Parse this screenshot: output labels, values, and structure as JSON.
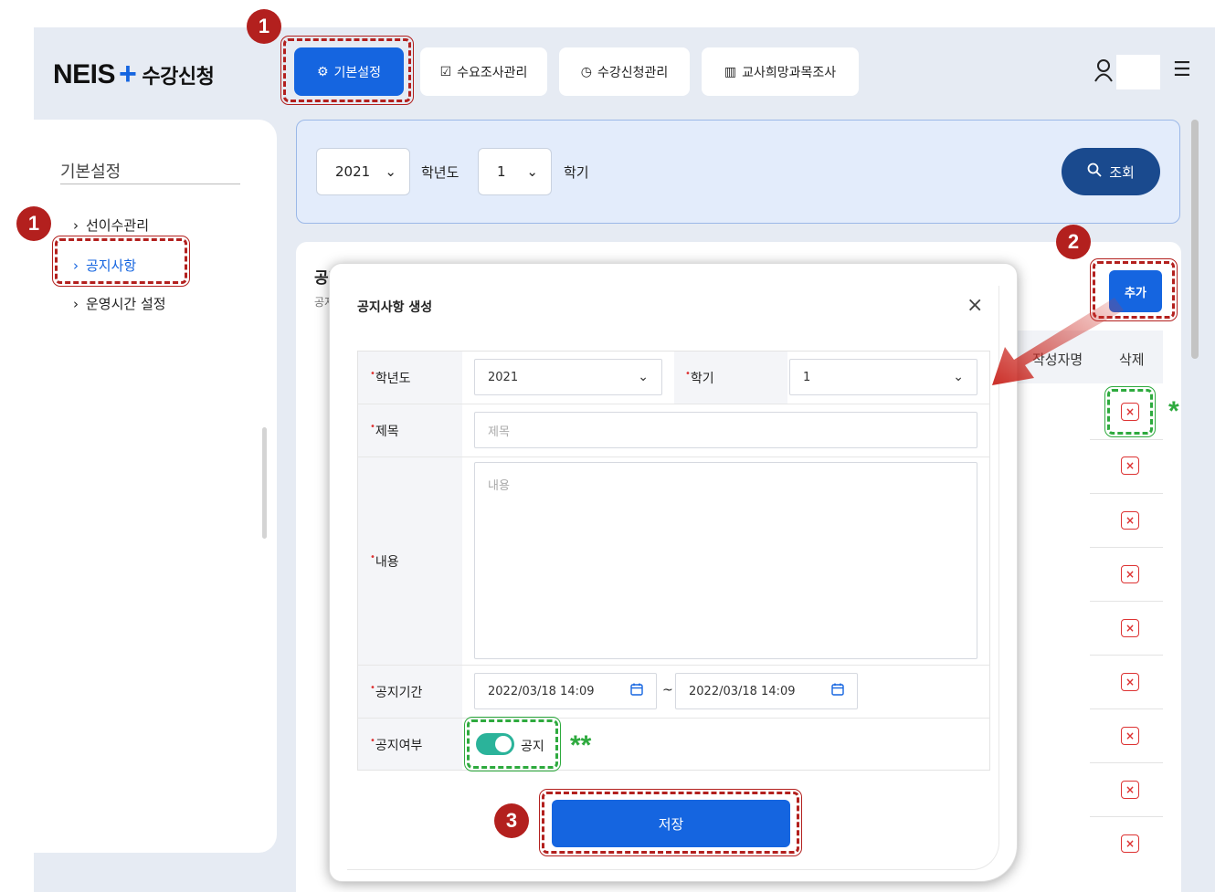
{
  "logo": {
    "brand": "NEIS",
    "plus": "+",
    "sub": "수강신청"
  },
  "tabs": [
    {
      "label": "기본설정",
      "icon": "gear-icon"
    },
    {
      "label": "수요조사관리",
      "icon": "check-circle-icon"
    },
    {
      "label": "수강신청관리",
      "icon": "clock-icon"
    },
    {
      "label": "교사희망과목조사",
      "icon": "bar-chart-icon"
    }
  ],
  "sidebar": {
    "title": "기본설정",
    "items": [
      "선이수관리",
      "공지사항",
      "운영시간 설정"
    ]
  },
  "filter": {
    "year": "2021",
    "year_label": "학년도",
    "semester": "1",
    "semester_label": "학기",
    "search_label": "조회"
  },
  "list": {
    "title": "공지사항",
    "subtitle": "공지",
    "add_label": "추가",
    "col_author": "작성자명",
    "col_delete": "삭제"
  },
  "modal": {
    "title": "공지사항 생성",
    "close": "×",
    "year_label": "학년도",
    "year_value": "2021",
    "semester_label": "학기",
    "semester_value": "1",
    "subject_label": "제목",
    "subject_placeholder": "제목",
    "content_label": "내용",
    "content_placeholder": "내용",
    "period_label": "공지기간",
    "period_start": "2022/03/18 14:09",
    "period_sep": "~",
    "period_end": "2022/03/18 14:09",
    "notice_label": "공지여부",
    "notice_toggle_label": "공지",
    "notice_on": true,
    "save_label": "저장"
  },
  "annotations": {
    "badge_1": "1",
    "badge_2": "2",
    "badge_3": "3",
    "star_single": "*",
    "star_double": "**"
  },
  "colors": {
    "primary": "#1565e0",
    "navy": "#1a4a8e",
    "highlight_red": "#b3201e",
    "highlight_green": "#2eaa3e",
    "toggle_on": "#2bb39a"
  }
}
